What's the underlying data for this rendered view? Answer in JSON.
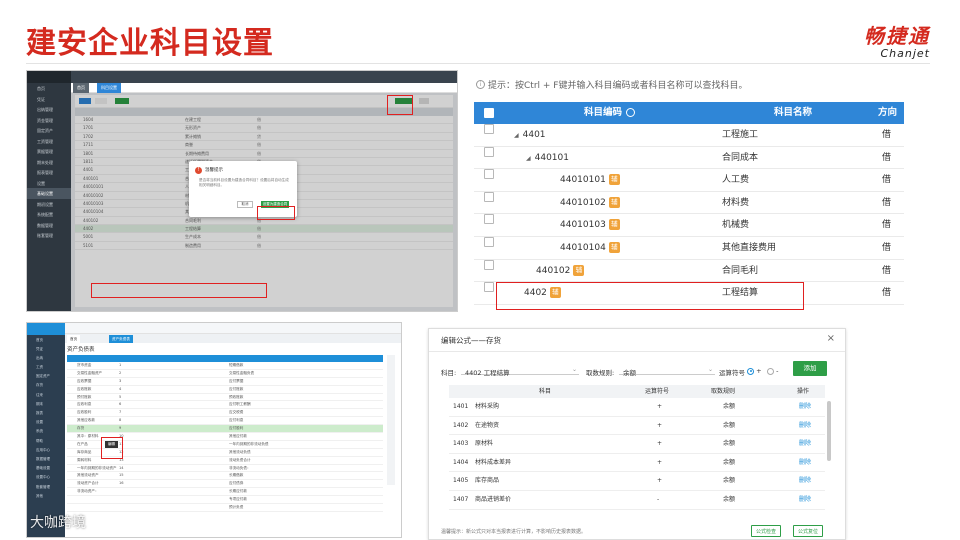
{
  "slide": {
    "title": "建安企业科目设置"
  },
  "logo": {
    "cn": "畅捷通",
    "en": "Chanjet"
  },
  "panel1": {
    "sidebar": [
      "首页",
      "凭证",
      "出纳管理",
      "资金管理",
      "固定资产",
      "工资管理",
      "票据管理",
      "期末处理",
      "报表管理",
      "设置",
      "基础设置",
      "期初设置",
      "系统配置",
      "数据管理",
      "账套管理"
    ],
    "tabs": [
      "首页",
      "科目设置"
    ],
    "rows": [
      {
        "code": "1604",
        "name": "在建工程",
        "dir": "借"
      },
      {
        "code": "1701",
        "name": "无形资产",
        "dir": "借"
      },
      {
        "code": "1702",
        "name": "累计摊销",
        "dir": "贷"
      },
      {
        "code": "1711",
        "name": "商誉",
        "dir": "借"
      },
      {
        "code": "1801",
        "name": "长期待摊费用",
        "dir": "借"
      },
      {
        "code": "1811",
        "name": "递延所得税资产",
        "dir": "借"
      },
      {
        "code": "4401",
        "name": "工程施工",
        "dir": "借"
      },
      {
        "code": "440101",
        "name": "合同成本",
        "dir": "借"
      },
      {
        "code": "44010101",
        "name": "人工费",
        "dir": "借"
      },
      {
        "code": "44010102",
        "name": "材料费",
        "dir": "借"
      },
      {
        "code": "44010103",
        "name": "机械费",
        "dir": "借"
      },
      {
        "code": "44010104",
        "name": "其他直接费用",
        "dir": "借"
      },
      {
        "code": "440102",
        "name": "合同毛利",
        "dir": "借"
      },
      {
        "code": "4402",
        "name": "工程结算",
        "dir": "借"
      },
      {
        "code": "5001",
        "name": "生产成本",
        "dir": "借"
      },
      {
        "code": "5101",
        "name": "制造费用",
        "dir": "借"
      }
    ],
    "dialog": {
      "title": "温馨提示",
      "message": "是否将当前科目设置为建造合同科目？设置后将自动生成相关明细科目。",
      "cancel": "取消",
      "confirm": "设置为建造合同"
    }
  },
  "panel2": {
    "hint": "提示：按Ctrl + F键并输入科目编码或者科目名称可以查找科目。",
    "headers": {
      "code": "科目编码",
      "name": "科目名称",
      "dir": "方向"
    },
    "rows": [
      {
        "code": "4401",
        "name": "工程施工",
        "dir": "借",
        "indent": 0,
        "tag": "",
        "arrow": "◢"
      },
      {
        "code": "440101",
        "name": "合同成本",
        "dir": "借",
        "indent": 1,
        "tag": "",
        "arrow": "◢"
      },
      {
        "code": "44010101",
        "name": "人工费",
        "dir": "借",
        "indent": 2,
        "tag": "辅",
        "arrow": ""
      },
      {
        "code": "44010102",
        "name": "材料费",
        "dir": "借",
        "indent": 2,
        "tag": "辅",
        "arrow": ""
      },
      {
        "code": "44010103",
        "name": "机械费",
        "dir": "借",
        "indent": 2,
        "tag": "辅",
        "arrow": ""
      },
      {
        "code": "44010104",
        "name": "其他直接费用",
        "dir": "借",
        "indent": 2,
        "tag": "辅",
        "arrow": ""
      },
      {
        "code": "440102",
        "name": "合同毛利",
        "dir": "借",
        "indent": 1,
        "tag": "辅",
        "arrow": ""
      },
      {
        "code": "4402",
        "name": "工程结算",
        "dir": "借",
        "indent": 0,
        "tag": "辅",
        "arrow": ""
      }
    ]
  },
  "panel3": {
    "tabs": [
      "首页",
      "资产负债表"
    ],
    "subtitle": "资产负债表",
    "sidebar": [
      "首页",
      "凭证",
      "出纳",
      "工资",
      "固定资产",
      "存货",
      "往来",
      "期末",
      "报表",
      "设置",
      "系统",
      "帮助",
      "应用中心",
      "数据管理",
      "基础设置",
      "设置中心",
      "账套管理",
      "其他"
    ],
    "rows": [
      {
        "a": "货币资金",
        "b": "1",
        "c": "短期借款"
      },
      {
        "a": "交易性金融资产",
        "b": "2",
        "c": "交易性金融负债"
      },
      {
        "a": "应收票据",
        "b": "3",
        "c": "应付票据"
      },
      {
        "a": "应收账款",
        "b": "4",
        "c": "应付账款"
      },
      {
        "a": "预付账款",
        "b": "5",
        "c": "预收账款"
      },
      {
        "a": "应收利息",
        "b": "6",
        "c": "应付职工薪酬"
      },
      {
        "a": "应收股利",
        "b": "7",
        "c": "应交税费"
      },
      {
        "a": "其他应收款",
        "b": "8",
        "c": "应付利息"
      },
      {
        "a": "存货",
        "b": "9",
        "c": "应付股利"
      },
      {
        "a": "其中：原材料",
        "b": "10",
        "c": "其他应付款"
      },
      {
        "a": "在产品",
        "b": "11",
        "c": "一年内到期的非流动负债"
      },
      {
        "a": "库存商品",
        "b": "12",
        "c": "其他流动负债"
      },
      {
        "a": "周转材料",
        "b": "13",
        "c": "流动负债合计"
      },
      {
        "a": "一年内到期的非流动资产",
        "b": "14",
        "c": "非流动负债："
      },
      {
        "a": "其他流动资产",
        "b": "15",
        "c": "长期借款"
      },
      {
        "a": "流动资产合计",
        "b": "16",
        "c": "应付债券"
      },
      {
        "a": "非流动资产：",
        "b": "",
        "c": "长期应付款"
      },
      {
        "a": "",
        "b": "",
        "c": "专项应付款"
      },
      {
        "a": "",
        "b": "",
        "c": "预计负债"
      }
    ],
    "tip": "编辑"
  },
  "panel4": {
    "title": "编辑公式——存货",
    "subject_label": "科目:",
    "subject_value": "4402 工程结算",
    "rule_label": "取数规则:",
    "rule_value": "余额",
    "op_label": "运算符号",
    "op_plus": "+",
    "op_minus": "-",
    "add": "添加",
    "headers": {
      "subject": "科目",
      "op": "运算符号",
      "rule": "取数规则",
      "action": "操作"
    },
    "rows": [
      {
        "code": "1401",
        "name": "材料采购",
        "op": "+",
        "rule": "余额",
        "action": "删除"
      },
      {
        "code": "1402",
        "name": "在途物资",
        "op": "+",
        "rule": "余额",
        "action": "删除"
      },
      {
        "code": "1403",
        "name": "原材料",
        "op": "+",
        "rule": "余额",
        "action": "删除"
      },
      {
        "code": "1404",
        "name": "材料成本差异",
        "op": "+",
        "rule": "余额",
        "action": "删除"
      },
      {
        "code": "1405",
        "name": "库存商品",
        "op": "+",
        "rule": "余额",
        "action": "删除"
      },
      {
        "code": "1407",
        "name": "商品进销差价",
        "op": "-",
        "rule": "余额",
        "action": "删除"
      }
    ],
    "footer": "温馨提示：新公式只对本当报表进行计算，不影响历史报表数据。",
    "btn_check": "公式检查",
    "btn_ok": "公式复位"
  },
  "watermark": "大咖跨境",
  "colors": {
    "brand_red": "#d42a1f",
    "header_blue": "#2f86d7",
    "accent_green": "#2e9e47",
    "tag_orange": "#f0a33a",
    "highlight_red": "#e02020"
  }
}
